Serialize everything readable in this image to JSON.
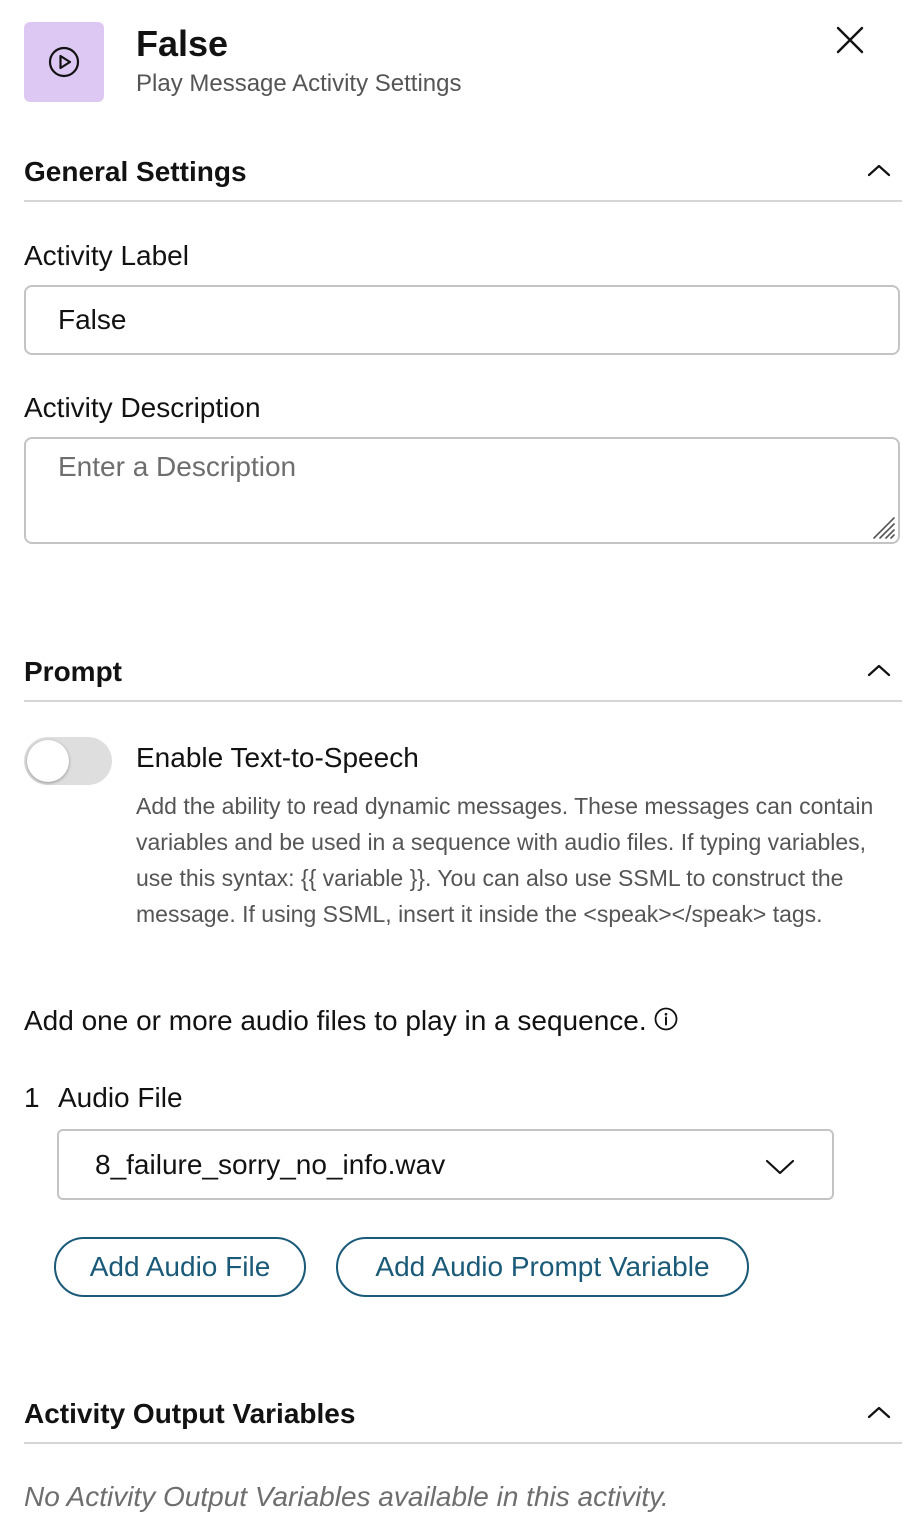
{
  "header": {
    "title": "False",
    "subtitle": "Play Message Activity Settings",
    "icon": "play-circle-icon",
    "icon_tile_color": "#ddc8f3"
  },
  "general_settings": {
    "title": "General Settings",
    "activity_label": {
      "label": "Activity Label",
      "value": "False"
    },
    "activity_description": {
      "label": "Activity Description",
      "placeholder": "Enter a Description"
    }
  },
  "prompt": {
    "title": "Prompt",
    "tts": {
      "label": "Enable Text-to-Speech",
      "enabled": false,
      "description": "Add the ability to read dynamic messages. These messages can contain variables and be used in a sequence with audio files. If typing variables, use this syntax: {{ variable }}. You can also use SSML to construct the message. If using SSML, insert it inside the <speak></speak> tags."
    },
    "audio_intro": "Add one or more audio files to play in a sequence.",
    "audio_files": [
      {
        "index": "1",
        "label": "Audio File",
        "value": "8_failure_sorry_no_info.wav"
      }
    ],
    "add_audio_file_label": "Add Audio File",
    "add_audio_prompt_variable_label": "Add Audio Prompt Variable"
  },
  "output_variables": {
    "title": "Activity Output Variables",
    "empty_text": "No Activity Output Variables available in this activity."
  },
  "colors": {
    "accent": "#1a5a78",
    "divider": "#d6d6d6",
    "input_border": "#c4c4c4"
  }
}
